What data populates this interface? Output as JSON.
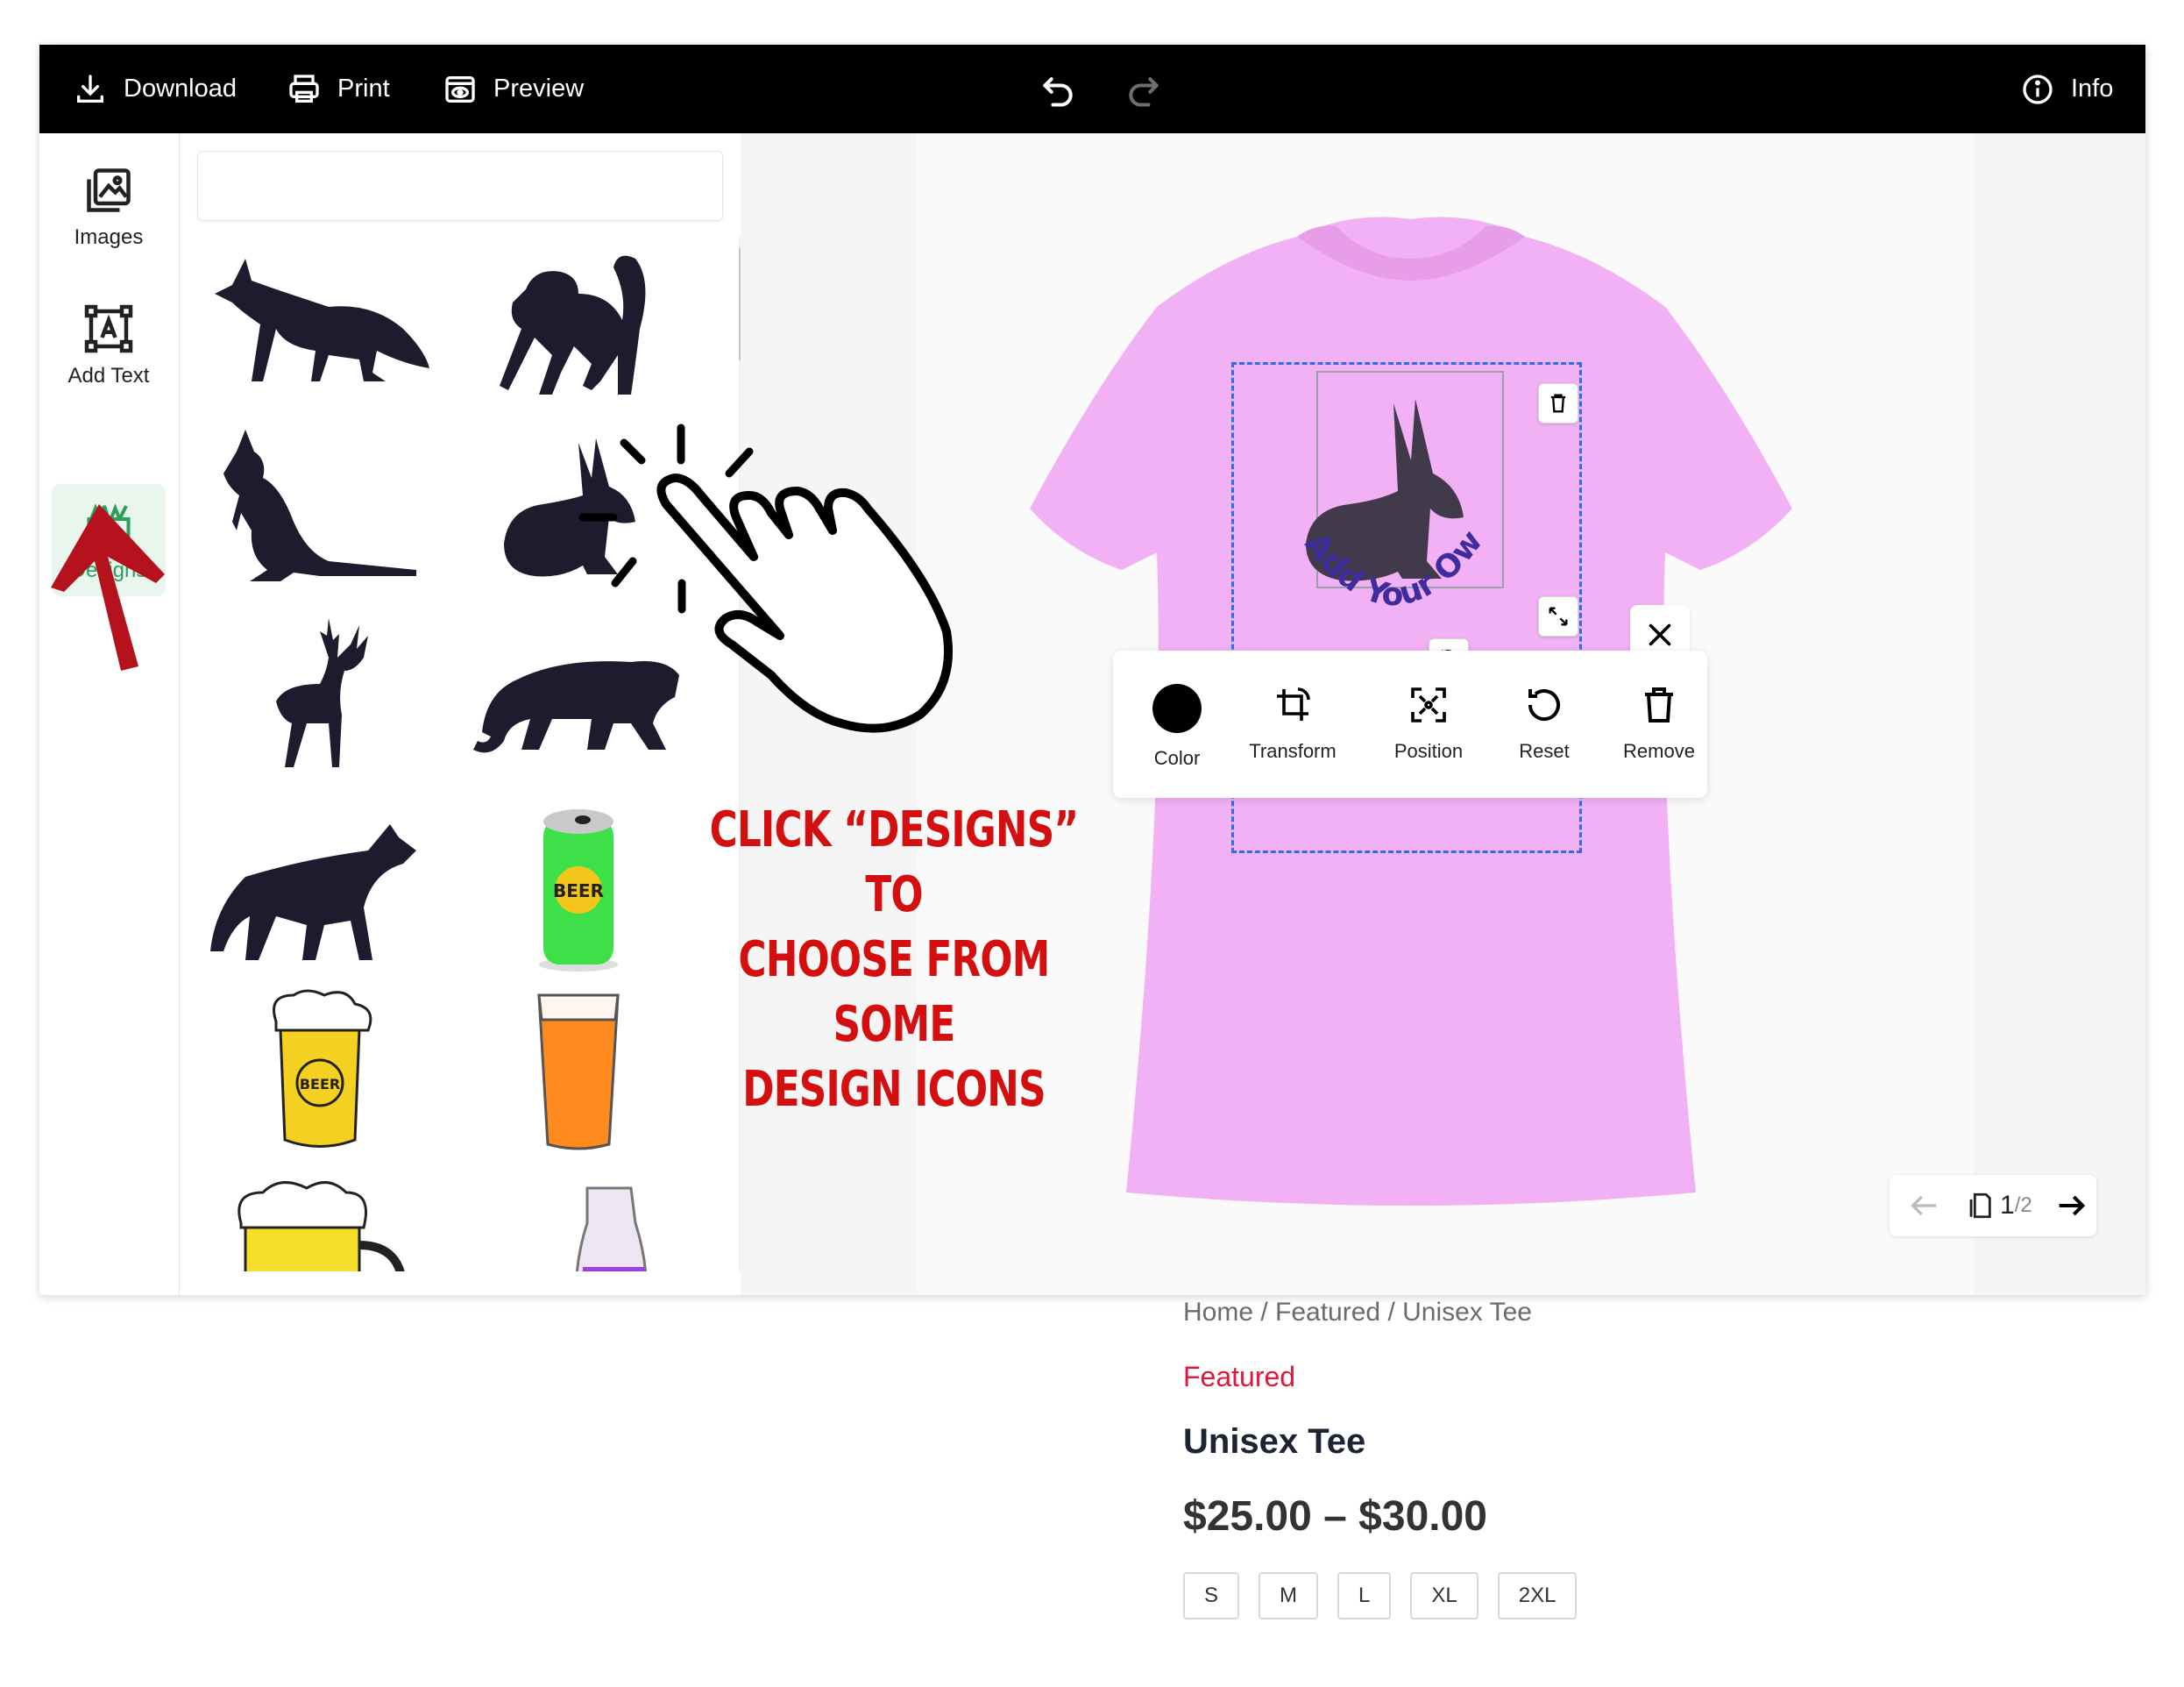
{
  "toolbar": {
    "download": "Download",
    "print": "Print",
    "preview": "Preview",
    "info": "Info"
  },
  "rail": {
    "items": [
      {
        "label": "Images",
        "icon": "images-icon"
      },
      {
        "label": "Add Text",
        "icon": "add-text-icon"
      },
      {
        "label": "Designs",
        "icon": "designs-icon",
        "active": true
      }
    ]
  },
  "panel": {
    "search_placeholder": "",
    "designs": [
      "fox",
      "monkey",
      "kangaroo",
      "rabbit",
      "deer",
      "tiger",
      "wolf",
      "beer-can",
      "beer-mug",
      "beer-pint",
      "beer-stein",
      "juice-jug"
    ],
    "beer_can_label": "BEER",
    "beer_mug_label": "BEER"
  },
  "canvas": {
    "design_text": "Add Your Own Text",
    "shirt_color": "#f3b3f6"
  },
  "context_toolbar": {
    "color": "Color",
    "transform": "Transform",
    "position": "Position",
    "reset": "Reset",
    "remove": "Remove"
  },
  "pager": {
    "current": "1",
    "total": "/2"
  },
  "annotation": {
    "line1": "CLICK “DESIGNS” TO",
    "line2": "CHOOSE FROM SOME",
    "line3": "DESIGN ICONS"
  },
  "product": {
    "breadcrumb": "Home / Featured / Unisex Tee",
    "category": "Featured",
    "title": "Unisex Tee",
    "price": "$25.00 – $30.00",
    "sizes": [
      "S",
      "M",
      "L",
      "XL",
      "2XL"
    ]
  },
  "colors": {
    "accent": "#2aa05a",
    "callout": "#d40f0f",
    "selection": "#2f6fe0",
    "category": "#e0183c"
  }
}
